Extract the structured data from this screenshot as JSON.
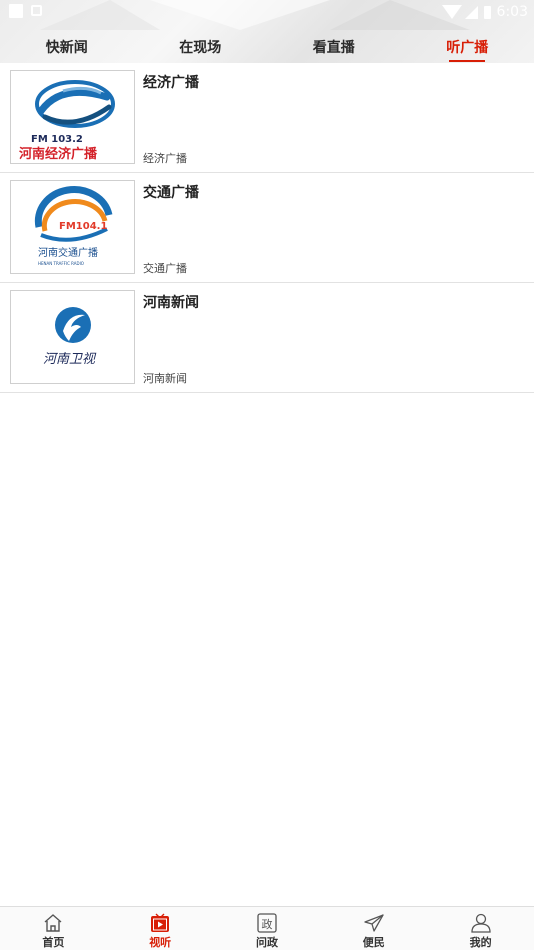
{
  "status_bar": {
    "time": "6:03"
  },
  "tabs": [
    {
      "label": "快新闻",
      "active": false
    },
    {
      "label": "在现场",
      "active": false
    },
    {
      "label": "看直播",
      "active": false
    },
    {
      "label": "听广播",
      "active": true
    }
  ],
  "stations": [
    {
      "title": "经济广播",
      "subtitle": "经济广播",
      "logo": {
        "freq": "FM 103.2",
        "name": "河南经济广播"
      }
    },
    {
      "title": "交通广播",
      "subtitle": "交通广播",
      "logo": {
        "freq": "FM104.1",
        "name": "河南交通广播",
        "en": "HENAN TRAFFIC RADIO"
      }
    },
    {
      "title": "河南新闻",
      "subtitle": "河南新闻",
      "logo": {
        "name": "河南卫视"
      }
    }
  ],
  "bottom_nav": [
    {
      "label": "首页",
      "icon": "home-icon",
      "active": false
    },
    {
      "label": "视听",
      "icon": "video-play-icon",
      "active": true
    },
    {
      "label": "问政",
      "icon": "government-icon",
      "active": false
    },
    {
      "label": "便民",
      "icon": "paper-plane-icon",
      "active": false
    },
    {
      "label": "我的",
      "icon": "user-icon",
      "active": false
    }
  ],
  "colors": {
    "accent": "#d81e06",
    "logo_blue": "#1a6fb5",
    "logo_red": "#d4222a",
    "logo_orange": "#f08a1c"
  }
}
